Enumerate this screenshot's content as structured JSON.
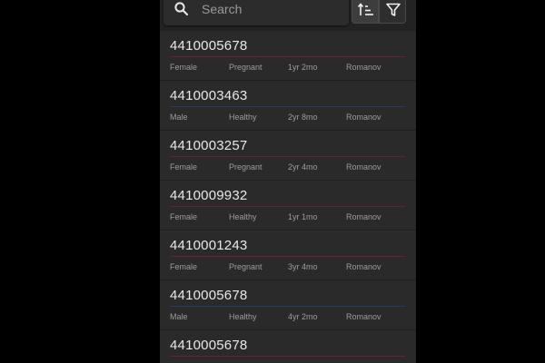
{
  "search": {
    "placeholder": "Search",
    "icon": "search-icon"
  },
  "toolbar": {
    "sort_icon": "sort-icon",
    "filter_icon": "filter-icon",
    "sort_active": true
  },
  "colors": {
    "female_line": "#6b2230",
    "male_line": "#2a3a66"
  },
  "animals": [
    {
      "id": "4410005678",
      "gender": "Female",
      "status": "Pregnant",
      "age": "1yr 2mo",
      "breed": "Romanov"
    },
    {
      "id": "4410003463",
      "gender": "Male",
      "status": "Healthy",
      "age": "2yr 8mo",
      "breed": "Romanov"
    },
    {
      "id": "4410003257",
      "gender": "Female",
      "status": "Pregnant",
      "age": "2yr 4mo",
      "breed": "Romanov"
    },
    {
      "id": "4410009932",
      "gender": "Female",
      "status": "Healthy",
      "age": "1yr 1mo",
      "breed": "Romanov"
    },
    {
      "id": "4410001243",
      "gender": "Female",
      "status": "Pregnant",
      "age": "3yr 4mo",
      "breed": "Romanov"
    },
    {
      "id": "4410005678",
      "gender": "Male",
      "status": "Healthy",
      "age": "4yr 2mo",
      "breed": "Romanov"
    },
    {
      "id": "4410005678",
      "gender": "",
      "status": "",
      "age": "",
      "breed": ""
    }
  ]
}
